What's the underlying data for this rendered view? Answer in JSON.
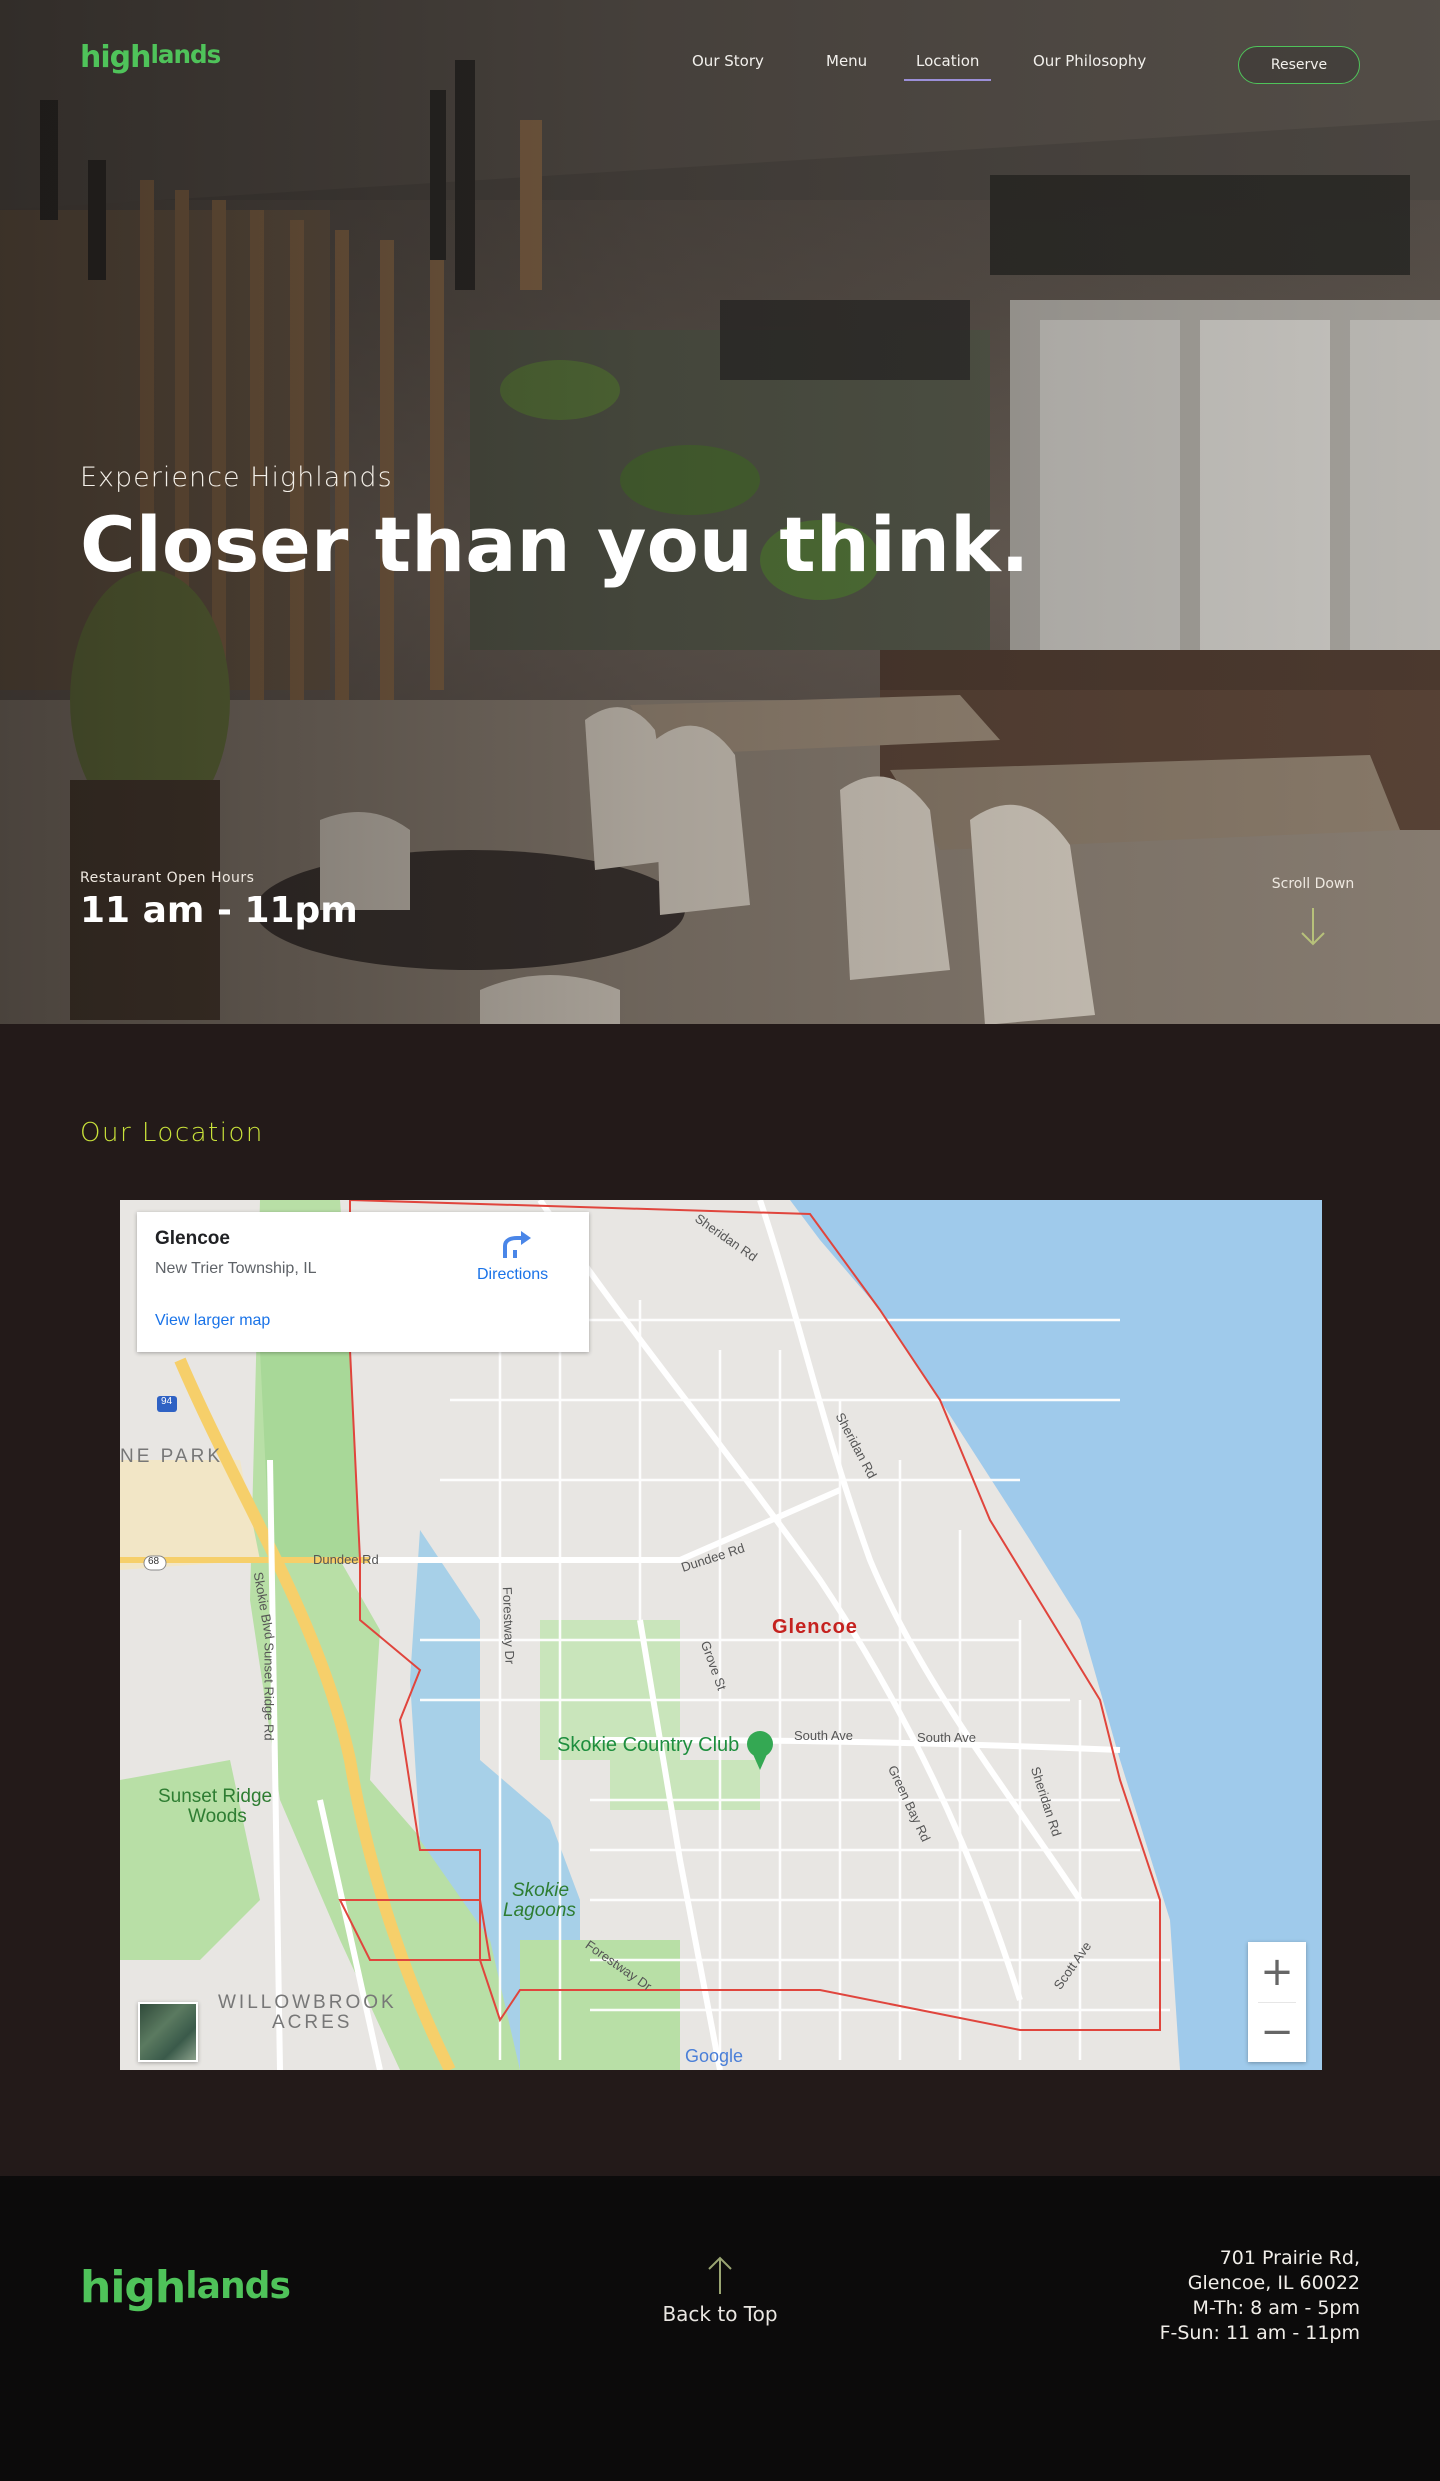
{
  "brand": {
    "logo_main": "high",
    "logo_sub": "lands",
    "color": "#4fc35a"
  },
  "nav": {
    "items": [
      {
        "label": "Our Story"
      },
      {
        "label": "Menu"
      },
      {
        "label": "Location",
        "active": true
      },
      {
        "label": "Our Philosophy"
      }
    ],
    "reserve_label": "Reserve"
  },
  "hero": {
    "eyebrow": "Experience Highlands",
    "headline": "Closer than you think.",
    "hours_label": "Restaurant Open Hours",
    "hours_value": "11 am - 11pm",
    "scroll_label": "Scroll Down"
  },
  "location": {
    "title": "Our Location",
    "title_color": "#c9e23a",
    "map": {
      "place_name": "Glencoe",
      "place_address": "New Trier Township, IL",
      "directions_label": "Directions",
      "larger_map_label": "View larger map",
      "zoom_in": "+",
      "zoom_out": "−",
      "attribution": "Google",
      "labels": {
        "glencoe": "Glencoe",
        "skokie_cc": "Skokie Country Club",
        "sunset_ridge_1": "Sunset Ridge",
        "sunset_ridge_2": "Woods",
        "skokie_lagoons_1": "Skokie",
        "skokie_lagoons_2": "Lagoons",
        "willowbrook_1": "WILLOWBROOK",
        "willowbrook_2": "ACRES",
        "ne_park": "NE PARK",
        "dundee_rd_1": "Dundee Rd",
        "dundee_rd_2": "Dundee Rd",
        "sheridan_rd_1": "Sheridan Rd",
        "sheridan_rd_2": "Sheridan Rd",
        "sheridan_rd_3": "Sheridan Rd",
        "south_ave_1": "South Ave",
        "south_ave_2": "South Ave",
        "green_bay_rd": "Green Bay Rd",
        "grove_st": "Grove St",
        "forestway_dr_1": "Forestway Dr",
        "forestway_dr_2": "Forestway Dr",
        "skokie_blvd": "Skokie Blvd",
        "sunset_ridge_rd": "Sunset Ridge Rd",
        "scott_ave": "Scott Ave",
        "hwy_94": "94",
        "hwy_68": "68"
      }
    }
  },
  "footer": {
    "back_to_top": "Back to Top",
    "address_line1": "701 Prairie Rd,",
    "address_line2": "Glencoe, IL 60022",
    "hours_line1": "M-Th: 8 am - 5pm",
    "hours_line2": "F-Sun: 11 am - 11pm"
  }
}
